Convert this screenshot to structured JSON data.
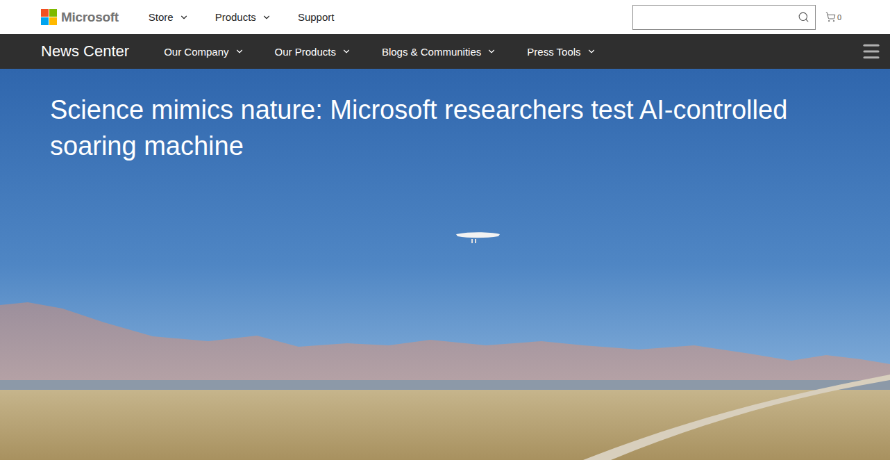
{
  "header": {
    "logo": "Microsoft",
    "nav": [
      {
        "label": "Store",
        "dropdown": true
      },
      {
        "label": "Products",
        "dropdown": true
      },
      {
        "label": "Support",
        "dropdown": false
      }
    ],
    "cart": {
      "count": "0"
    }
  },
  "subnav": {
    "title": "News Center",
    "items": [
      {
        "label": "Our Company",
        "dropdown": true
      },
      {
        "label": "Our Products",
        "dropdown": true
      },
      {
        "label": "Blogs & Communities",
        "dropdown": true
      },
      {
        "label": "Press Tools",
        "dropdown": true
      }
    ]
  },
  "hero": {
    "headline": "Science mimics nature: Microsoft researchers test AI-controlled soaring machine"
  }
}
